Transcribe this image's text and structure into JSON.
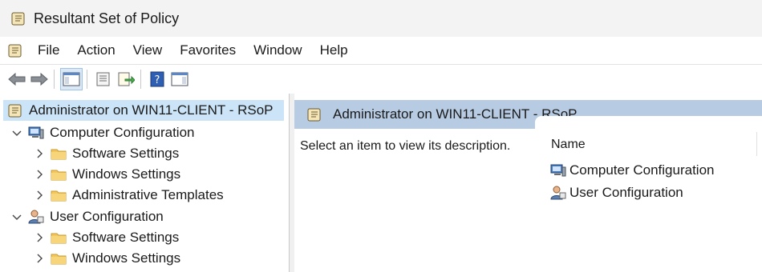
{
  "window": {
    "title": "Resultant Set of Policy"
  },
  "menu": {
    "items": [
      "File",
      "Action",
      "View",
      "Favorites",
      "Window",
      "Help"
    ]
  },
  "toolbar": {
    "buttons": [
      "back-arrow-icon",
      "forward-arrow-icon",
      "show-hide-console-tree-icon",
      "properties-icon",
      "export-list-icon",
      "help-icon",
      "show-hide-action-pane-icon"
    ]
  },
  "tree": {
    "root": "Administrator on WIN11-CLIENT - RSoP",
    "computer_configuration": {
      "label": "Computer Configuration",
      "children": [
        "Software Settings",
        "Windows Settings",
        "Administrative Templates"
      ]
    },
    "user_configuration": {
      "label": "User Configuration",
      "children": [
        "Software Settings",
        "Windows Settings"
      ]
    }
  },
  "details": {
    "header": "Administrator on WIN11-CLIENT - RSoP",
    "description": "Select an item to view its description.",
    "column_name": "Name",
    "items": [
      "Computer Configuration",
      "User Configuration"
    ]
  },
  "colors": {
    "selection": "#cce4f7",
    "header_band": "#b7cbe3",
    "folder": "#f2c75c"
  }
}
